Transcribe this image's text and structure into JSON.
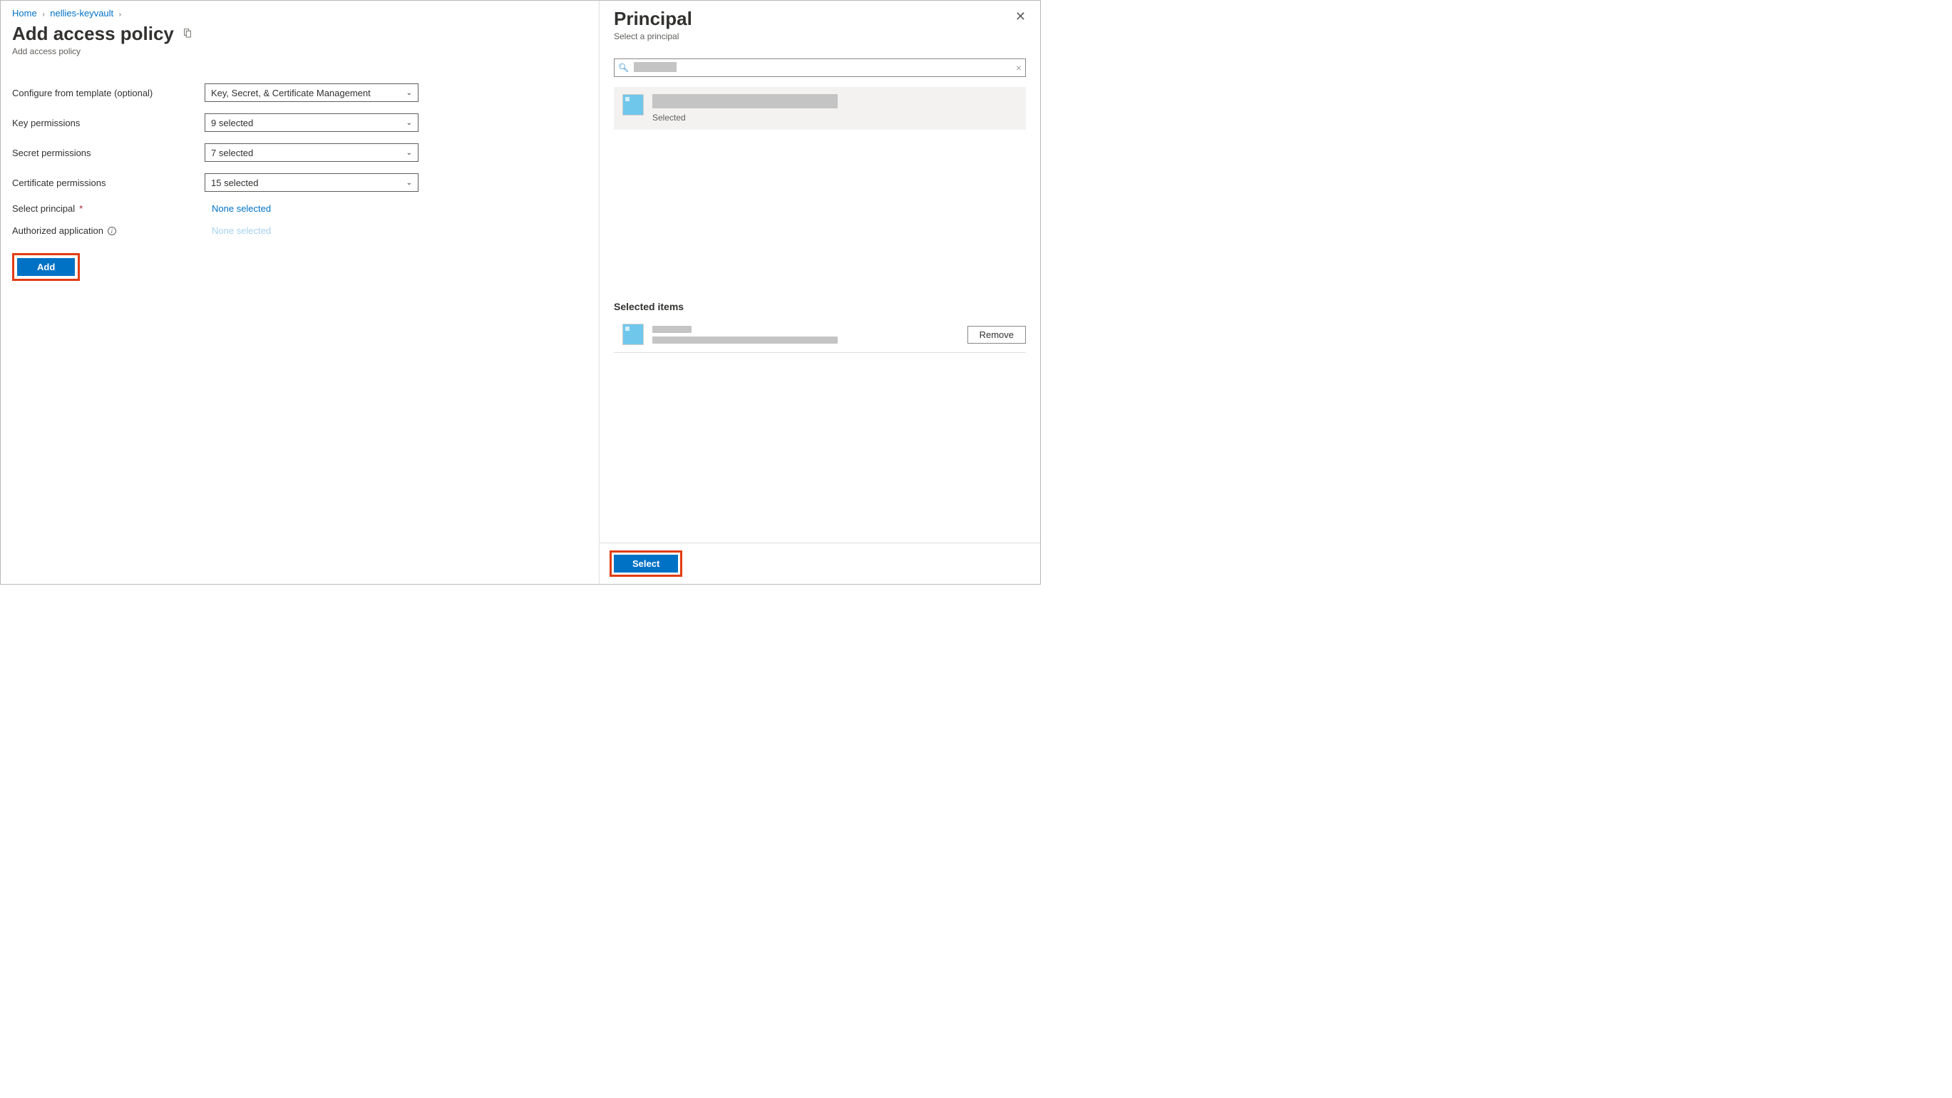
{
  "breadcrumb": {
    "home": "Home",
    "kv": "nellies-keyvault"
  },
  "page": {
    "title": "Add access policy",
    "subtitle": "Add access policy"
  },
  "form": {
    "template_label": "Configure from template (optional)",
    "template_value": "Key, Secret, & Certificate Management",
    "key_label": "Key permissions",
    "key_value": "9 selected",
    "secret_label": "Secret permissions",
    "secret_value": "7 selected",
    "cert_label": "Certificate permissions",
    "cert_value": "15 selected",
    "principal_label": "Select principal",
    "principal_value": "None selected",
    "app_label": "Authorized application",
    "app_value": "None selected",
    "add_button": "Add"
  },
  "panel": {
    "title": "Principal",
    "subtitle": "Select a principal",
    "selected_label": "Selected",
    "section_heading": "Selected items",
    "remove_button": "Remove",
    "select_button": "Select"
  }
}
